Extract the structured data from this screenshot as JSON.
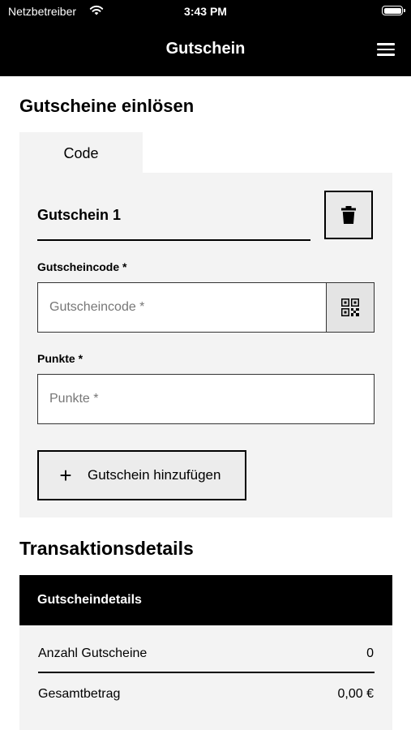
{
  "status_bar": {
    "carrier": "Netzbetreiber",
    "time": "3:43 PM"
  },
  "nav": {
    "title": "Gutschein"
  },
  "page": {
    "title": "Gutscheine einlösen"
  },
  "tabs": [
    {
      "label": "Code",
      "active": true
    }
  ],
  "voucher": {
    "title": "Gutschein 1",
    "code_label": "Gutscheincode *",
    "code_placeholder": "Gutscheincode *",
    "code_value": "",
    "points_label": "Punkte *",
    "points_placeholder": "Punkte *",
    "points_value": ""
  },
  "add_button": {
    "label": "Gutschein hinzufügen"
  },
  "transaction": {
    "title": "Transaktionsdetails",
    "header": "Gutscheindetails",
    "rows": [
      {
        "label": "Anzahl Gutscheine",
        "value": "0"
      },
      {
        "label": "Gesamtbetrag",
        "value": "0,00 €"
      }
    ]
  },
  "icons": {
    "menu": "hamburger-menu-icon",
    "delete": "trash-icon",
    "scan": "qr-code-icon",
    "add": "plus-icon",
    "wifi": "wifi-icon",
    "battery": "battery-icon"
  },
  "colors": {
    "header_bg": "#000000",
    "card_bg": "#f3f3f3",
    "text": "#000000"
  }
}
